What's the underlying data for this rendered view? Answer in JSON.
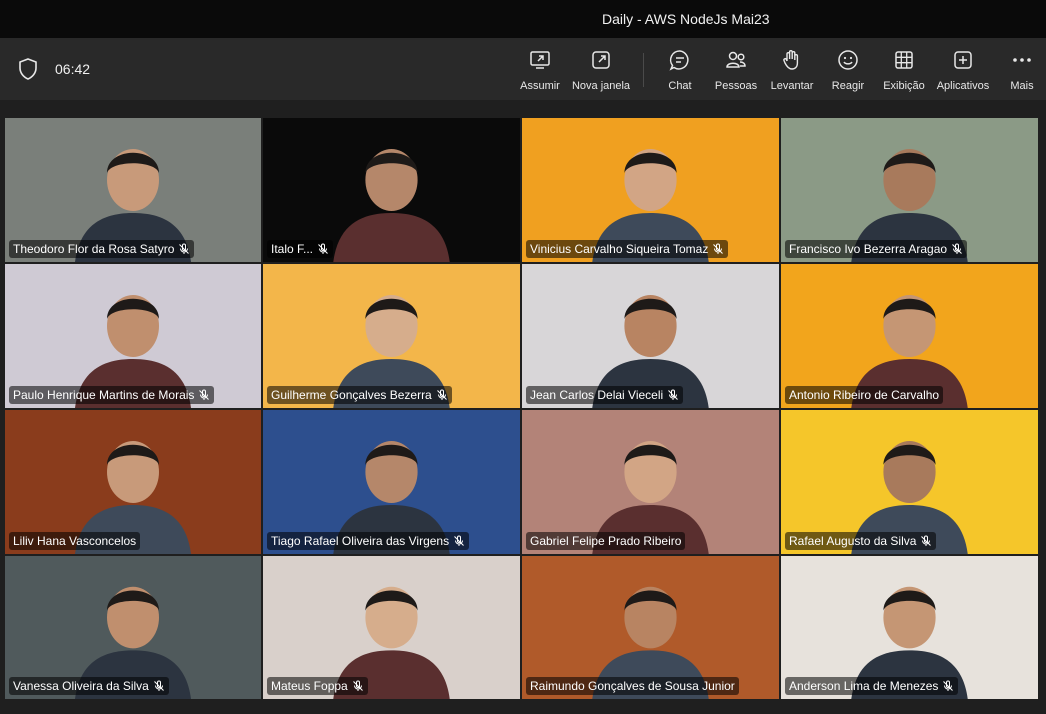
{
  "window": {
    "title": "Daily - AWS NodeJs Mai23"
  },
  "toolbar": {
    "timer": "06:42",
    "buttons": [
      {
        "id": "assumir",
        "label": "Assumir",
        "icon": "share-screen-icon"
      },
      {
        "id": "nova-janela",
        "label": "Nova janela",
        "icon": "popout-icon"
      },
      {
        "id": "chat",
        "label": "Chat",
        "icon": "chat-icon"
      },
      {
        "id": "pessoas",
        "label": "Pessoas",
        "icon": "people-icon"
      },
      {
        "id": "levantar",
        "label": "Levantar",
        "icon": "raise-hand-icon"
      },
      {
        "id": "reagir",
        "label": "Reagir",
        "icon": "emoji-icon"
      },
      {
        "id": "exibicao",
        "label": "Exibição",
        "icon": "grid-view-icon"
      },
      {
        "id": "aplicativos",
        "label": "Aplicativos",
        "icon": "add-app-icon"
      },
      {
        "id": "mais",
        "label": "Mais",
        "icon": "more-icon"
      }
    ]
  },
  "participants": [
    {
      "name": "Theodoro Flor da Rosa Satyro",
      "muted": true,
      "bg": "#7a7f7a"
    },
    {
      "name": "Italo F...",
      "muted": true,
      "bg": "#0a0a0a"
    },
    {
      "name": "Vinicius Carvalho Siqueira Tomaz",
      "muted": true,
      "bg": "#f0a020"
    },
    {
      "name": "Francisco Ivo Bezerra Aragao",
      "muted": true,
      "bg": "#8b9a86"
    },
    {
      "name": "Paulo Henrique Martins de Morais",
      "muted": true,
      "bg": "#cfcad4"
    },
    {
      "name": "Guilherme Gonçalves Bezerra",
      "muted": true,
      "bg": "#f3b64a"
    },
    {
      "name": "Jean Carlos Delai Vieceli",
      "muted": true,
      "bg": "#d8d6d8"
    },
    {
      "name": "Antonio Ribeiro de Carvalho",
      "muted": false,
      "bg": "#f2a51c"
    },
    {
      "name": "Liliv Hana Vasconcelos",
      "muted": false,
      "bg": "#8a3c1c"
    },
    {
      "name": "Tiago Rafael Oliveira das Virgens",
      "muted": true,
      "bg": "#2d4f8e"
    },
    {
      "name": "Gabriel Felipe Prado Ribeiro",
      "muted": false,
      "bg": "#b38378"
    },
    {
      "name": "Rafael Augusto da Silva",
      "muted": true,
      "bg": "#f5c62a"
    },
    {
      "name": "Vanessa Oliveira da Silva",
      "muted": true,
      "bg": "#505a5c"
    },
    {
      "name": "Mateus Foppa",
      "muted": true,
      "bg": "#d9d0cb"
    },
    {
      "name": "Raimundo Gonçalves de Sousa Junior",
      "muted": false,
      "bg": "#b05a2a"
    },
    {
      "name": "Anderson Lima de Menezes",
      "muted": true,
      "bg": "#e7e2dc"
    }
  ]
}
